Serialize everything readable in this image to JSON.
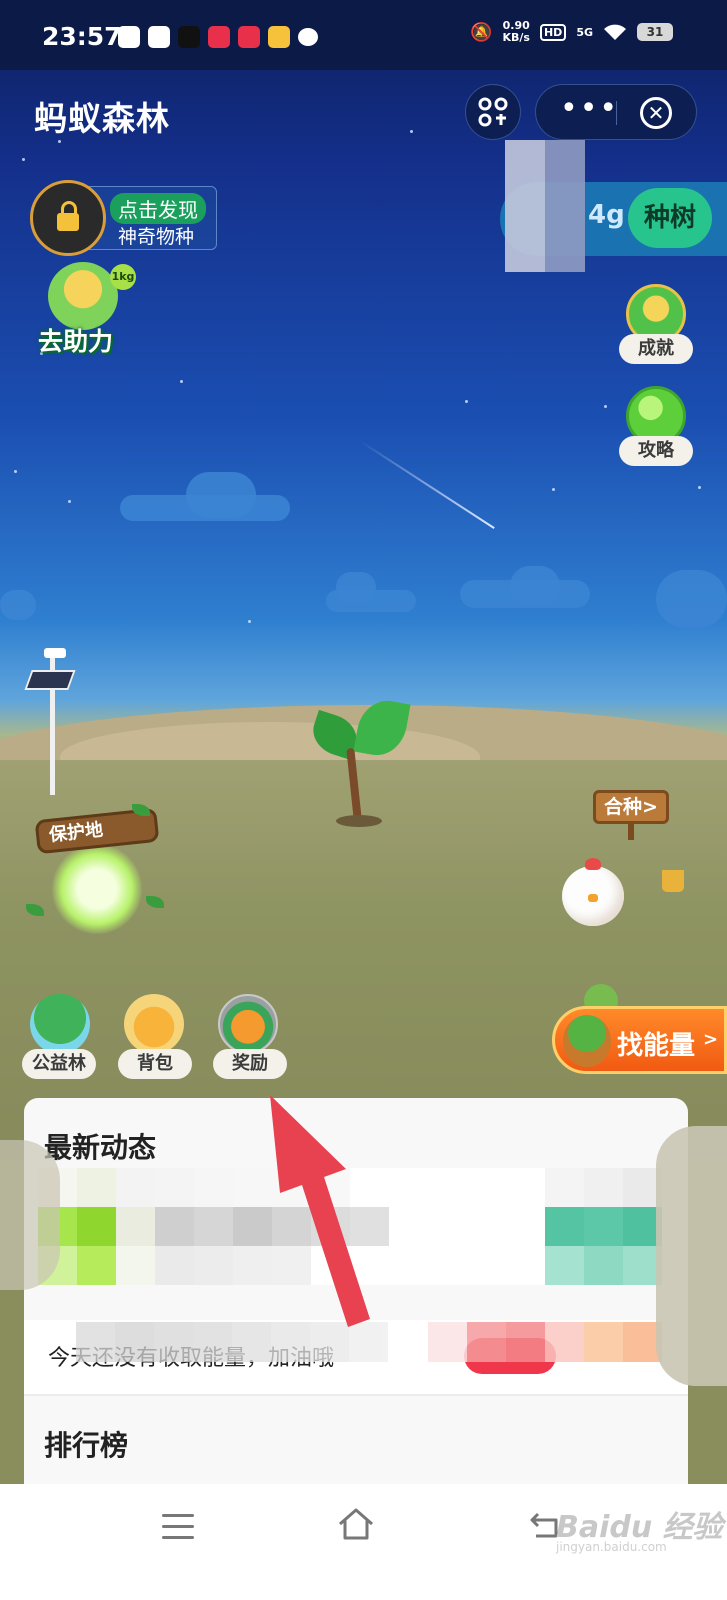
{
  "status_bar": {
    "time": "23:57",
    "net_speed_value": "0.90",
    "net_speed_unit": "KB/s",
    "hd_label": "HD",
    "network_label": "5G",
    "battery": "31"
  },
  "header": {
    "title": "蚂蚁森林"
  },
  "discover": {
    "line1": "点击发现",
    "line2": "神奇物种"
  },
  "energy_panel": {
    "energy_suffix": "4g",
    "plant_label": "种树"
  },
  "help": {
    "badge": "1kg",
    "label": "去助力"
  },
  "side_buttons": {
    "achievement_label": "成就",
    "guide_label": "攻略"
  },
  "scene": {
    "reserve_sign": "保护地",
    "hezhong_sign": "合种",
    "hezhong_chevron": ">"
  },
  "bottom_buttons": {
    "public_forest": "公益林",
    "backpack": "背包",
    "reward": "奖励",
    "find_energy": "找能量",
    "find_energy_chevron": ">"
  },
  "news_card": {
    "title": "最新动态",
    "message": "今天还没有收取能量，加油哦",
    "ranking_title": "排行榜"
  },
  "watermark": {
    "brand": "Baidu 经验",
    "url": "jingyan.baidu.com"
  },
  "colors": {
    "plant_button": "#27c48e",
    "find_energy": "#f15a12",
    "annotation_arrow": "#e8414f"
  }
}
